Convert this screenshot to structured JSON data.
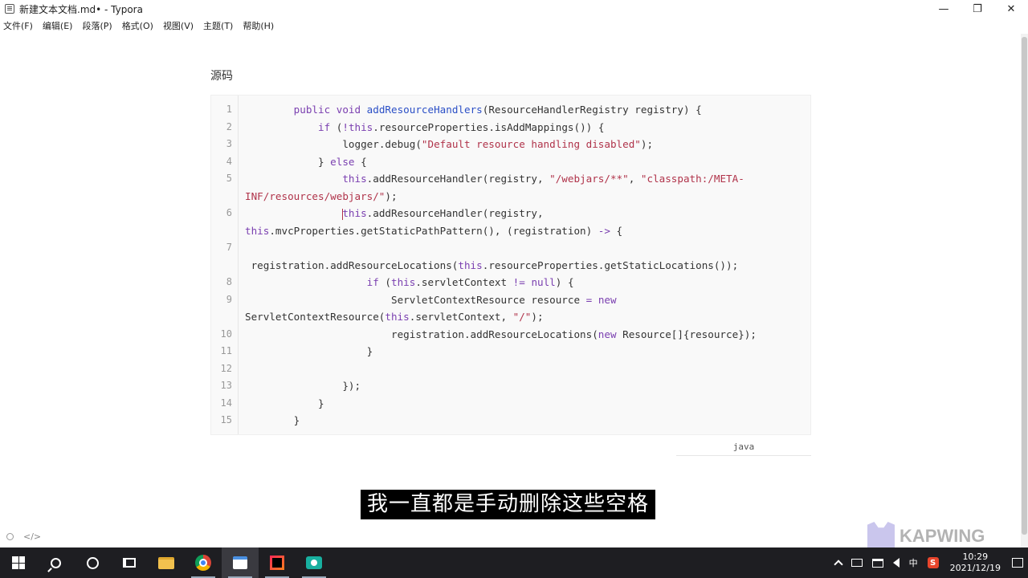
{
  "window": {
    "title": "新建文本文档.md• - Typora",
    "controls": {
      "minimize": "—",
      "restore": "❐",
      "close": "✕"
    }
  },
  "menu": [
    "文件(F)",
    "编辑(E)",
    "段落(P)",
    "格式(O)",
    "视图(V)",
    "主题(T)",
    "帮助(H)"
  ],
  "document": {
    "heading": "源码",
    "code_language": "java",
    "code_lines": [
      {
        "number": "1",
        "indent": "        ",
        "tokens": [
          {
            "t": "kw",
            "v": "public void "
          },
          {
            "t": "fn",
            "v": "addResourceHandlers"
          },
          {
            "t": "",
            "v": "(ResourceHandlerRegistry registry) {"
          }
        ]
      },
      {
        "number": "2",
        "indent": "            ",
        "tokens": [
          {
            "t": "kw",
            "v": "if "
          },
          {
            "t": "",
            "v": "("
          },
          {
            "t": "op",
            "v": "!"
          },
          {
            "t": "kw",
            "v": "this"
          },
          {
            "t": "",
            "v": ".resourceProperties.isAddMappings()) {"
          }
        ]
      },
      {
        "number": "3",
        "indent": "                ",
        "tokens": [
          {
            "t": "",
            "v": "logger.debug("
          },
          {
            "t": "st",
            "v": "\"Default resource handling disabled\""
          },
          {
            "t": "",
            "v": ");"
          }
        ]
      },
      {
        "number": "4",
        "indent": "            ",
        "tokens": [
          {
            "t": "",
            "v": "} "
          },
          {
            "t": "kw",
            "v": "else "
          },
          {
            "t": "",
            "v": "{"
          }
        ]
      },
      {
        "number": "5",
        "indent": "                ",
        "tokens": [
          {
            "t": "kw",
            "v": "this"
          },
          {
            "t": "",
            "v": ".addResourceHandler(registry, "
          },
          {
            "t": "st",
            "v": "\"/webjars/**\""
          },
          {
            "t": "",
            "v": ", "
          },
          {
            "t": "st",
            "v": "\"classpath:/META-"
          }
        ]
      },
      {
        "number": "",
        "indent": "",
        "tokens": [
          {
            "t": "st",
            "v": "INF/resources/webjars/\""
          },
          {
            "t": "",
            "v": ");"
          }
        ]
      },
      {
        "number": "6",
        "indent": "                ",
        "caret": true,
        "tokens": [
          {
            "t": "kw",
            "v": "this"
          },
          {
            "t": "",
            "v": ".addResourceHandler(registry,"
          }
        ]
      },
      {
        "number": "",
        "indent": "",
        "tokens": [
          {
            "t": "kw",
            "v": "this"
          },
          {
            "t": "",
            "v": ".mvcProperties.getStaticPathPattern(), (registration) "
          },
          {
            "t": "op",
            "v": "->"
          },
          {
            "t": "",
            "v": " {"
          }
        ]
      },
      {
        "number": "7",
        "indent": "",
        "tokens": []
      },
      {
        "number": "",
        "indent": " ",
        "tokens": [
          {
            "t": "",
            "v": "registration.addResourceLocations("
          },
          {
            "t": "kw",
            "v": "this"
          },
          {
            "t": "",
            "v": ".resourceProperties.getStaticLocations());"
          }
        ]
      },
      {
        "number": "8",
        "indent": "                    ",
        "tokens": [
          {
            "t": "kw",
            "v": "if "
          },
          {
            "t": "",
            "v": "("
          },
          {
            "t": "kw",
            "v": "this"
          },
          {
            "t": "",
            "v": ".servletContext "
          },
          {
            "t": "op",
            "v": "!="
          },
          {
            "t": "",
            "v": " "
          },
          {
            "t": "kw",
            "v": "null"
          },
          {
            "t": "",
            "v": ") {"
          }
        ]
      },
      {
        "number": "9",
        "indent": "                        ",
        "tokens": [
          {
            "t": "",
            "v": "ServletContextResource resource "
          },
          {
            "t": "op",
            "v": "="
          },
          {
            "t": "",
            "v": " "
          },
          {
            "t": "kw",
            "v": "new"
          }
        ]
      },
      {
        "number": "",
        "indent": "",
        "tokens": [
          {
            "t": "",
            "v": "ServletContextResource("
          },
          {
            "t": "kw",
            "v": "this"
          },
          {
            "t": "",
            "v": ".servletContext, "
          },
          {
            "t": "st",
            "v": "\"/\""
          },
          {
            "t": "",
            "v": ");"
          }
        ]
      },
      {
        "number": "10",
        "indent": "                        ",
        "tokens": [
          {
            "t": "",
            "v": "registration.addResourceLocations("
          },
          {
            "t": "kw",
            "v": "new"
          },
          {
            "t": "",
            "v": " Resource[]{resource});"
          }
        ]
      },
      {
        "number": "11",
        "indent": "                    ",
        "tokens": [
          {
            "t": "",
            "v": "}"
          }
        ]
      },
      {
        "number": "12",
        "indent": "",
        "tokens": []
      },
      {
        "number": "13",
        "indent": "                ",
        "tokens": [
          {
            "t": "",
            "v": "});"
          }
        ]
      },
      {
        "number": "14",
        "indent": "            ",
        "tokens": [
          {
            "t": "",
            "v": "}"
          }
        ]
      },
      {
        "number": "15",
        "indent": "        ",
        "tokens": [
          {
            "t": "",
            "v": "}"
          }
        ]
      }
    ]
  },
  "subtitle": "我一直都是手动删除这些空格",
  "status_bar": {
    "source_toggle": "</>"
  },
  "watermark": {
    "text": "KAPWING"
  },
  "taskbar": {
    "tray": {
      "ime": "中",
      "sogou": "S",
      "time": "10:29",
      "date": "2021/12/19"
    }
  },
  "colors": {
    "keyword": "#7a3fb0",
    "function": "#2b4fc6",
    "string": "#b0334a",
    "taskbar": "#1e1e22"
  }
}
